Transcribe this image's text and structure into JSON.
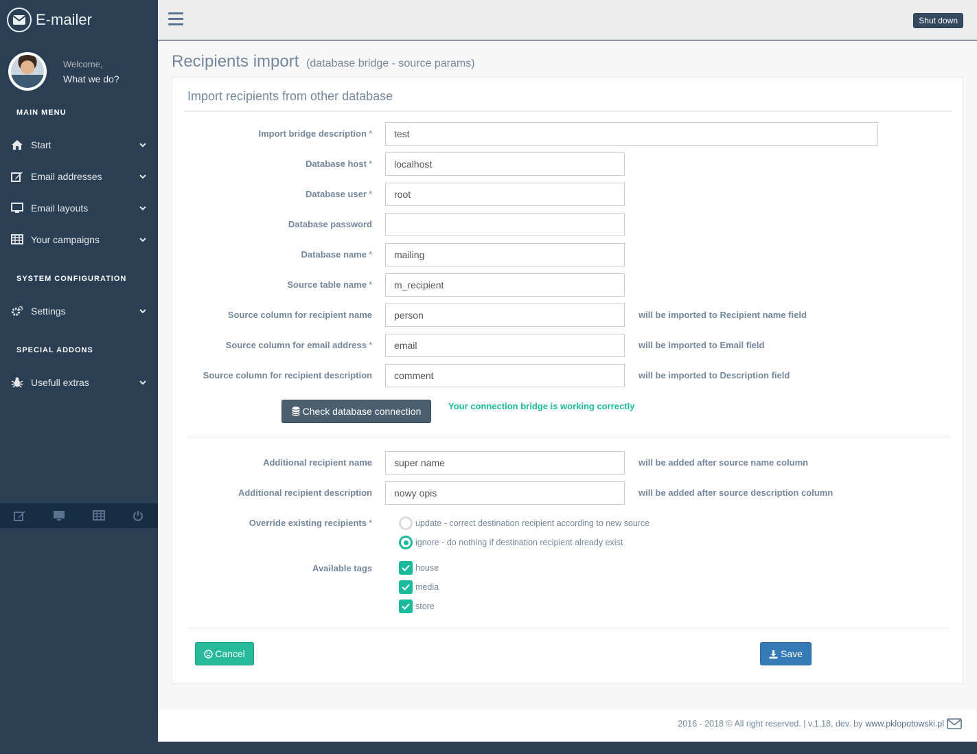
{
  "brand": {
    "name": "E-mailer",
    "icon": "envelope-icon"
  },
  "profile": {
    "welcome": "Welcome,",
    "name": "What we do?"
  },
  "sidebar": {
    "section_main": "MAIN MENU",
    "main_items": [
      {
        "label": "Start",
        "icon": "home-icon"
      },
      {
        "label": "Email addresses",
        "icon": "edit-icon"
      },
      {
        "label": "Email layouts",
        "icon": "desktop-icon"
      },
      {
        "label": "Your campaigns",
        "icon": "table-icon"
      }
    ],
    "section_system": "SYSTEM CONFIGURATION",
    "system_items": [
      {
        "label": "Settings",
        "icon": "cogs-icon"
      }
    ],
    "section_addons": "SPECIAL ADDONS",
    "addon_items": [
      {
        "label": "Usefull extras",
        "icon": "bug-icon"
      }
    ],
    "footer_icons": [
      "edit-icon",
      "desktop-icon",
      "table-icon",
      "power-icon"
    ]
  },
  "topnav": {
    "shutdown_label": "Shut down"
  },
  "page": {
    "title": "Recipients import",
    "subtitle": "(database bridge - source params)",
    "panel_title": "Import recipients from other database"
  },
  "form": {
    "import_desc": {
      "label": "Import bridge description",
      "required": "*",
      "value": "test"
    },
    "db_host": {
      "label": "Database host",
      "required": "*",
      "value": "localhost"
    },
    "db_user": {
      "label": "Database user",
      "required": "*",
      "value": "root"
    },
    "db_password": {
      "label": "Database password",
      "value": ""
    },
    "db_name": {
      "label": "Database name",
      "required": "*",
      "value": "mailing"
    },
    "src_table": {
      "label": "Source table name",
      "required": "*",
      "value": "m_recipient"
    },
    "src_name_col": {
      "label": "Source column for recipient name",
      "value": "person",
      "hint": "will be imported to Recipient name field"
    },
    "src_email_col": {
      "label": "Source column for email address",
      "required": "*",
      "value": "email",
      "hint": "will be imported to Email field"
    },
    "src_desc_col": {
      "label": "Source column for recipient description",
      "value": "comment",
      "hint": "will be imported to Description field"
    },
    "check_button": "Check database connection",
    "check_status": "Your connection bridge is working correctly",
    "add_name": {
      "label": "Additional recipient name",
      "value": "super name",
      "hint": "will be added after source name column"
    },
    "add_desc": {
      "label": "Additional recipient description",
      "value": "nowy opis",
      "hint": "will be added after source description column"
    },
    "override": {
      "label": "Override existing recipients",
      "required": "*",
      "options": [
        {
          "label": "update - correct destination recipient according to new source",
          "checked": false
        },
        {
          "label": "ignore - do nothing if destination recipient already exist",
          "checked": true
        }
      ]
    },
    "tags": {
      "label": "Available tags",
      "items": [
        {
          "label": "house",
          "checked": true
        },
        {
          "label": "media",
          "checked": true
        },
        {
          "label": "store",
          "checked": true
        }
      ]
    },
    "cancel_label": "Cancel",
    "save_label": "Save"
  },
  "footer": {
    "text": "2016 - 2018 © All right reserved. | v.1.18, dev. by",
    "link": "www.pklopotowski.pl"
  },
  "colors": {
    "sidebar": "#2a3f54",
    "accent": "#1abb9c",
    "primary": "#337ab7",
    "dark_button": "#4b5f71"
  }
}
